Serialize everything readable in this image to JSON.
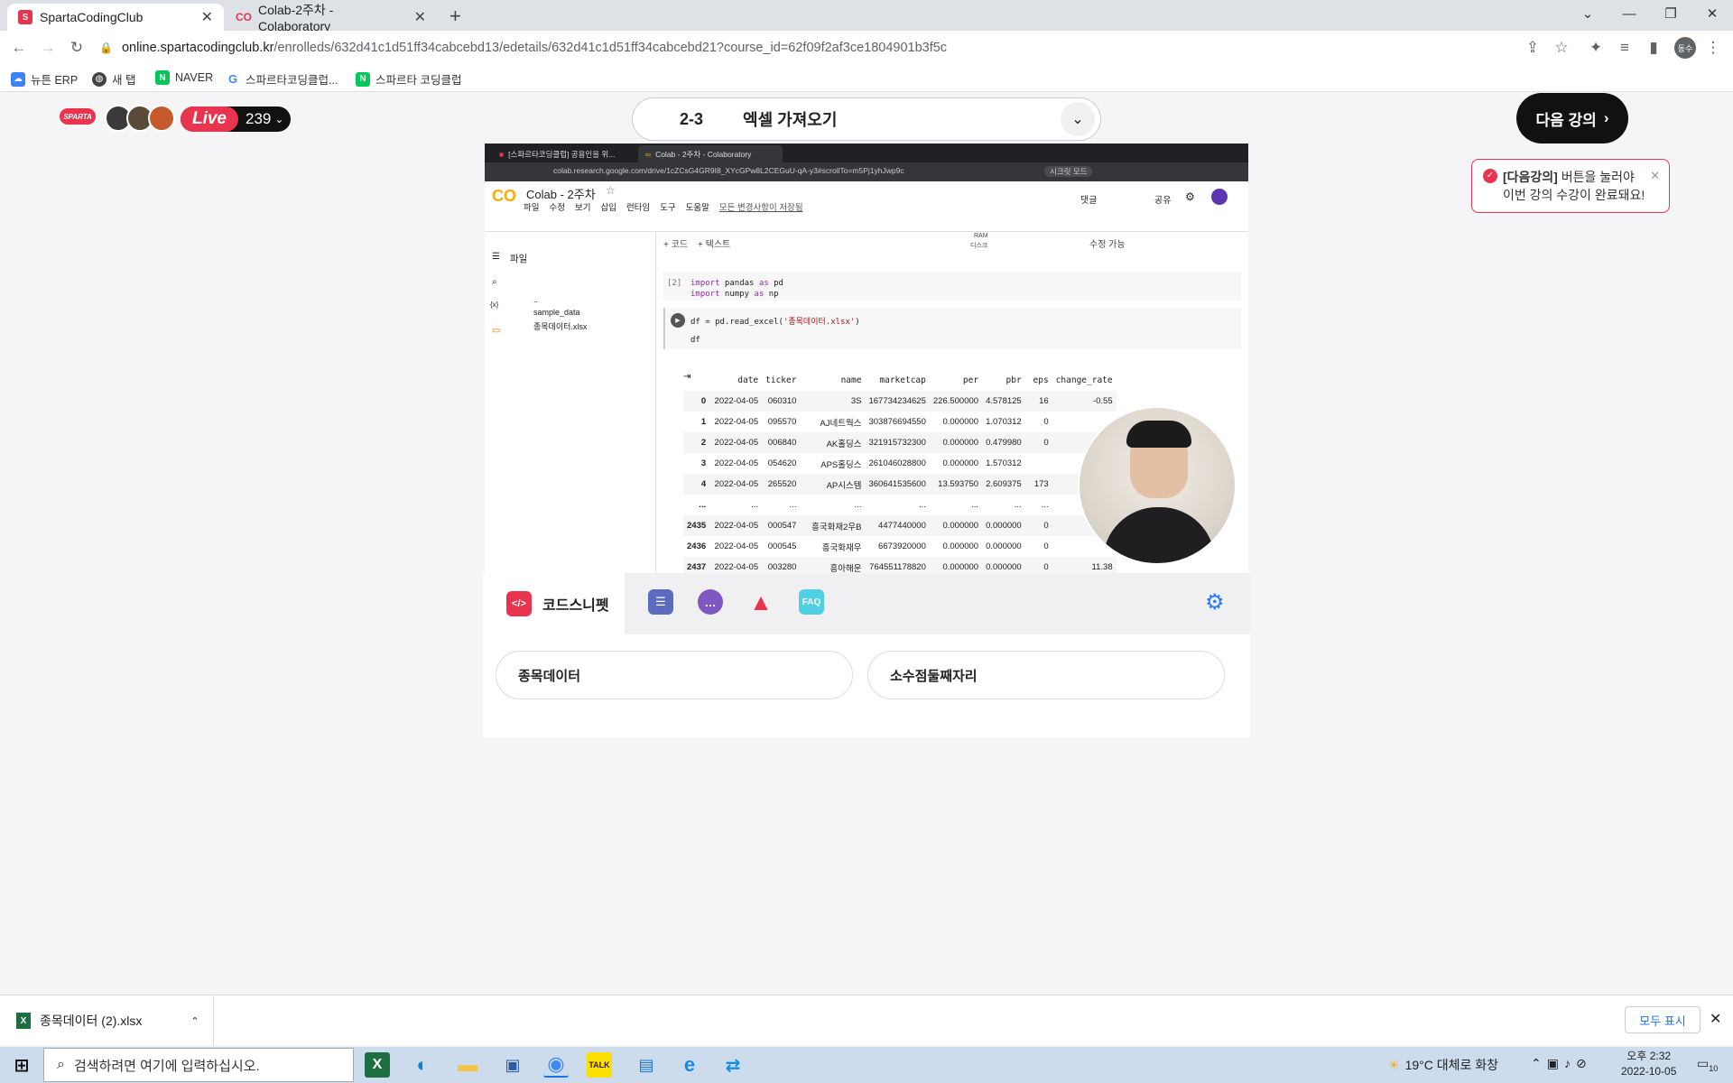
{
  "browser": {
    "tabs": [
      {
        "title": "SpartaCodingClub",
        "active": true
      },
      {
        "title": "Colab-2주차 - Colaboratory",
        "active": false
      }
    ],
    "url_host": "online.spartacodingclub.kr",
    "url_path": "/enrolleds/632d41c1d51ff34cabcebd13/edetails/632d41c1d51ff34cabcebd21?course_id=62f09f2af3ce1804901b3f5c",
    "bookmarks": [
      "뉴튼 ERP",
      "새 탭",
      "NAVER",
      "스파르타코딩클럽...",
      "스파르타 코딩클럽"
    ],
    "profile_initials": "동수"
  },
  "header": {
    "live_label": "Live",
    "live_count": "239",
    "lesson_number": "2-3",
    "lesson_title": "엑셀 가져오기",
    "next_button": "다음 강의",
    "toast_bold": "[다음강의]",
    "toast_rest": " 버튼을 눌러야",
    "toast_line2": "이번 강의 수강이 완료돼요!"
  },
  "video": {
    "inner_tabs": [
      "[스파르타코딩클럽] 공용인을 위...",
      "Colab - 2주차 - Colaboratory"
    ],
    "inner_url": "colab.research.google.com/drive/1cZCsG4GR9I8_XYcGPw8L2CEGuU-qA-y3#scrollTo=m5Pj1yhJwp9c",
    "incognito_label": "시크릿 모드",
    "notebook_title": "Colab - 2주차",
    "menu": [
      "파일",
      "수정",
      "보기",
      "삽입",
      "런타임",
      "도구",
      "도움말"
    ],
    "saved_msg": "모든 변경사항이 저장됨",
    "comment": "댓글",
    "share": "공유",
    "add_code": "+ 코드",
    "add_text": "+ 텍스트",
    "ram_label": "RAM",
    "disk_label": "디스크",
    "edit_mode": "수정 가능",
    "sidebar_title": "파일",
    "files": [
      "..",
      "sample_data",
      "종목데이터.xlsx"
    ],
    "disk_status": "디스크",
    "cell1_exec": "[2]",
    "cell1_line1_kw": "import",
    "cell1_line1_rest": " pandas ",
    "cell1_line1_as": "as",
    "cell1_line1_alias": " pd",
    "cell1_line2_kw": "import",
    "cell1_line2_rest": " numpy ",
    "cell1_line2_as": "as",
    "cell1_line2_alias": " np",
    "cell2_line1_pre": "df = pd.read_excel(",
    "cell2_line1_str": "'종목데이터.xlsx'",
    "cell2_line1_post": ")",
    "cell2_line2": "df"
  },
  "dataframe": {
    "columns": [
      "",
      "date",
      "ticker",
      "name",
      "marketcap",
      "per",
      "pbr",
      "eps",
      "change_rate"
    ],
    "rows": [
      [
        "0",
        "2022-04-05",
        "060310",
        "3S",
        "167734234625",
        "226.500000",
        "4.578125",
        "16",
        "-0.55"
      ],
      [
        "1",
        "2022-04-05",
        "095570",
        "AJ네트웍스",
        "303876694550",
        "0.000000",
        "1.070312",
        "0",
        ""
      ],
      [
        "2",
        "2022-04-05",
        "006840",
        "AK홀딩스",
        "321915732300",
        "0.000000",
        "0.479980",
        "0",
        ""
      ],
      [
        "3",
        "2022-04-05",
        "054620",
        "APS홀딩스",
        "261046028800",
        "0.000000",
        "1.570312",
        "",
        ""
      ],
      [
        "4",
        "2022-04-05",
        "265520",
        "AP시스템",
        "360641535600",
        "13.593750",
        "2.609375",
        "173",
        ""
      ],
      [
        "...",
        "...",
        "...",
        "...",
        "...",
        "...",
        "...",
        "...",
        ""
      ],
      [
        "2435",
        "2022-04-05",
        "000547",
        "흥국화재2우B",
        "4477440000",
        "0.000000",
        "0.000000",
        "0",
        ""
      ],
      [
        "2436",
        "2022-04-05",
        "000545",
        "흥국화재우",
        "6673920000",
        "0.000000",
        "0.000000",
        "0",
        ""
      ],
      [
        "2437",
        "2022-04-05",
        "003280",
        "흥아해운",
        "764551178820",
        "0.000000",
        "0.000000",
        "0",
        "11.38"
      ]
    ]
  },
  "panel": {
    "active_tab": "코드스니펫",
    "other_tab_icons": [
      "checklist-icon",
      "chat-icon",
      "warning-icon",
      "faq-icon"
    ],
    "faq_label": "FAQ",
    "snippets": [
      "종목데이터",
      "소수점둘째자리"
    ]
  },
  "download": {
    "file": "종목데이터 (2).xlsx",
    "show_all": "모두 표시"
  },
  "taskbar": {
    "search_placeholder": "검색하려면 여기에 입력하십시오.",
    "weather": "19°C 대체로 화창",
    "time": "오후 2:32",
    "date": "2022-10-05",
    "notif_count": "10"
  },
  "colors": {
    "accent": "#e8344e",
    "dark": "#111111",
    "colab_orange": "#f9ab00"
  }
}
